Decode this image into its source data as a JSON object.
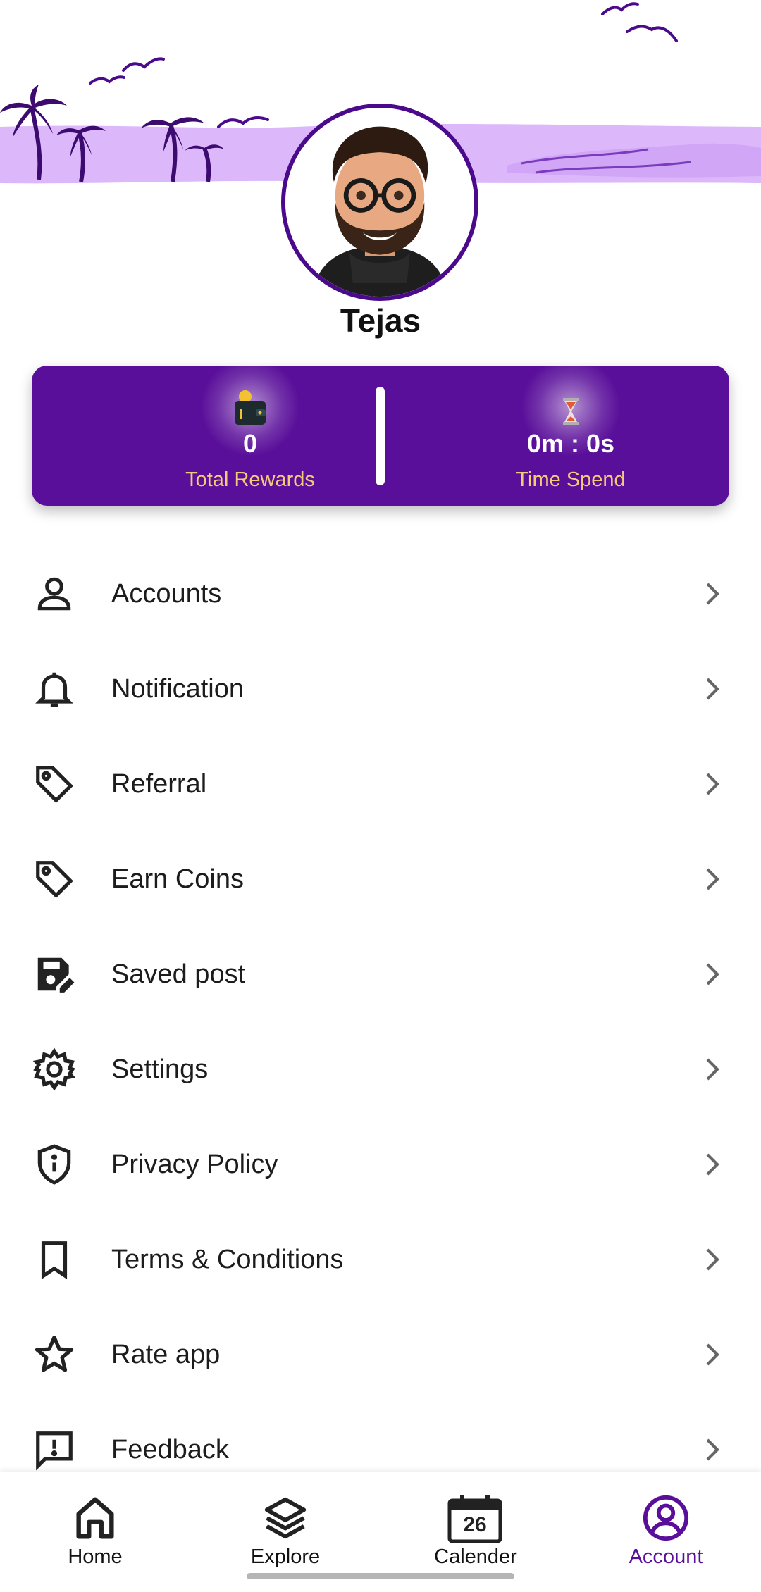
{
  "profile": {
    "name": "Tejas",
    "avatar": "memoji-avatar"
  },
  "stats": {
    "rewards": {
      "value": "0",
      "label": "Total Rewards",
      "icon": "wallet-icon"
    },
    "time": {
      "value": "0m : 0s",
      "label": "Time Spend",
      "icon": "hourglass-icon"
    }
  },
  "menu": [
    {
      "label": "Accounts",
      "icon": "person-icon"
    },
    {
      "label": "Notification",
      "icon": "bell-icon"
    },
    {
      "label": "Referral",
      "icon": "tag-icon"
    },
    {
      "label": "Earn Coins",
      "icon": "tag-icon"
    },
    {
      "label": "Saved post",
      "icon": "save-edit-icon"
    },
    {
      "label": "Settings",
      "icon": "gear-icon"
    },
    {
      "label": "Privacy Policy",
      "icon": "shield-info-icon"
    },
    {
      "label": "Terms & Conditions",
      "icon": "bookmark-icon"
    },
    {
      "label": "Rate app",
      "icon": "star-icon"
    },
    {
      "label": "Feedback",
      "icon": "feedback-icon"
    }
  ],
  "bottom_nav": [
    {
      "label": "Home",
      "icon": "home-icon"
    },
    {
      "label": "Explore",
      "icon": "layers-icon"
    },
    {
      "label": "Calender",
      "icon": "calendar-icon",
      "day": "26"
    },
    {
      "label": "Account",
      "icon": "account-circle-icon",
      "active": true
    }
  ],
  "colors": {
    "brand": "#5a0f9a",
    "accent_label": "#f6c97a",
    "header_wave": "#dcb8fb"
  }
}
